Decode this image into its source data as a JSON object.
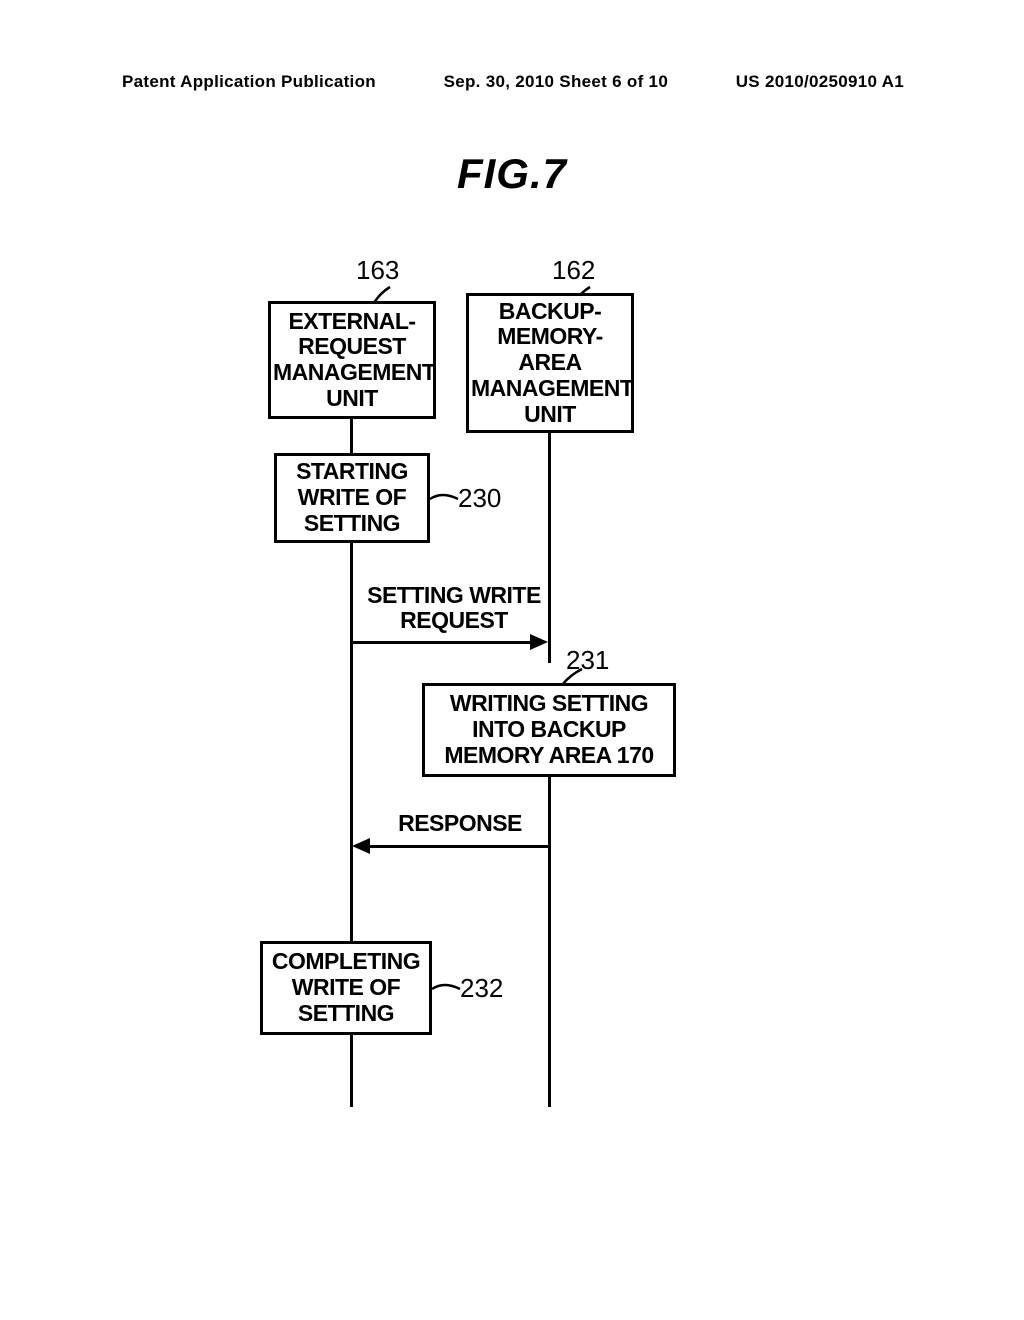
{
  "header": {
    "left": "Patent Application Publication",
    "center": "Sep. 30, 2010  Sheet 6 of 10",
    "right": "US 2010/0250910 A1"
  },
  "figure_title": "FIG.7",
  "refs": {
    "r163": "163",
    "r162": "162",
    "r230": "230",
    "r231": "231",
    "r232": "232"
  },
  "boxes": {
    "external_request": "EXTERNAL-\nREQUEST\nMANAGEMENT\nUNIT",
    "backup_memory": "BACKUP-\nMEMORY-\nAREA\nMANAGEMENT\nUNIT",
    "start_write": "STARTING\nWRITE OF\nSETTING",
    "write_action": "WRITING SETTING\nINTO BACKUP\nMEMORY AREA 170",
    "complete_write": "COMPLETING\nWRITE OF\nSETTING"
  },
  "messages": {
    "setting_write_request": "SETTING WRITE\nREQUEST",
    "response": "RESPONSE"
  }
}
